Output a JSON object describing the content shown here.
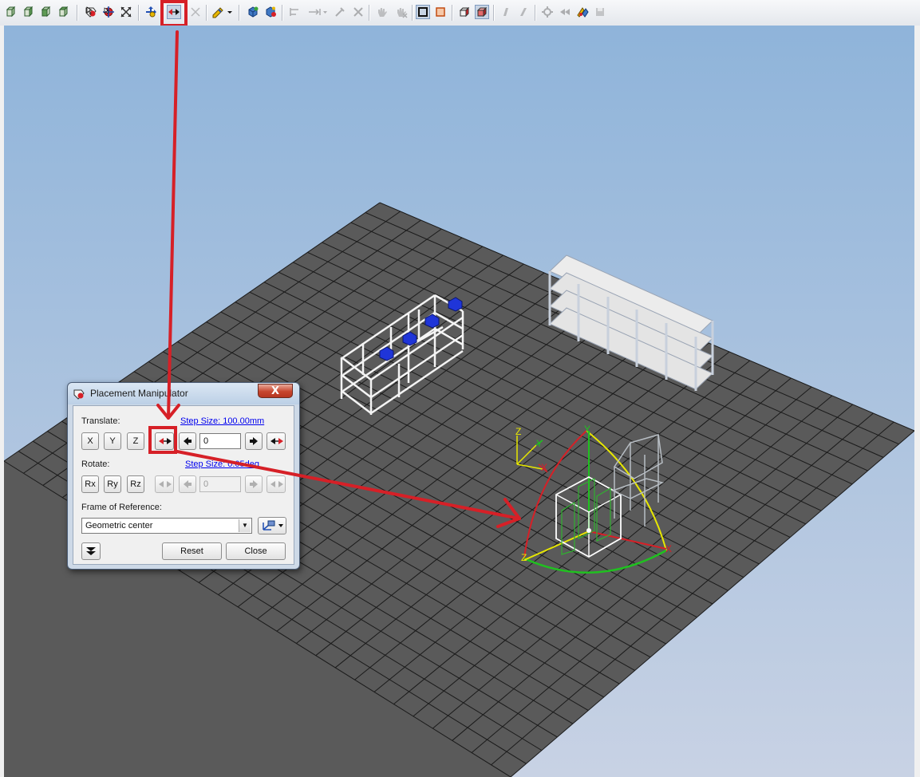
{
  "toolbar": {
    "icons": [
      "iso-view-front-icon",
      "iso-view-right-icon",
      "iso-view-left-icon",
      "iso-view-back-icon",
      "select-mode-icon",
      "move-select-icon",
      "scale-icon",
      "snap-axes-icon",
      "place-manipulator-icon",
      "disabled-tool-icon",
      "pencil-dropdown-icon",
      "scene-object-icon",
      "object-settings-icon",
      "align-icon",
      "distribute-icon",
      "tool-icon",
      "delete-icon",
      "hand-icon",
      "hand-cross-icon",
      "frame-view-icon",
      "frame-outline-icon",
      "box-view-icon",
      "solid-box-icon",
      "shape-icon",
      "shape2-icon",
      "gear-icon",
      "rewind-icon",
      "render-icon",
      "save-view-icon"
    ]
  },
  "dialog": {
    "title": "Placement Manipulator",
    "close_label": "X",
    "translate": {
      "label": "Translate:",
      "step_size": "Step Size: 100.00mm",
      "axes": [
        "X",
        "Y",
        "Z"
      ],
      "value": "0"
    },
    "rotate": {
      "label": "Rotate:",
      "step_size": "Step Size: 0.05deg",
      "axes": [
        "Rx",
        "Ry",
        "Rz"
      ],
      "value": "0"
    },
    "frame": {
      "label": "Frame of Reference:",
      "value": "Geometric center"
    },
    "reset_label": "Reset",
    "close_button_label": "Close"
  },
  "scene": {
    "gizmo_labels": [
      "Z",
      "Y",
      "X",
      "Y",
      "Z",
      "X"
    ],
    "colors": {
      "sky_top": "#8fb4da",
      "sky_bottom": "#c8d2e4",
      "floor": "#5a5a5a",
      "grid": "#1a1a1a",
      "annotation": "#d62027"
    }
  }
}
